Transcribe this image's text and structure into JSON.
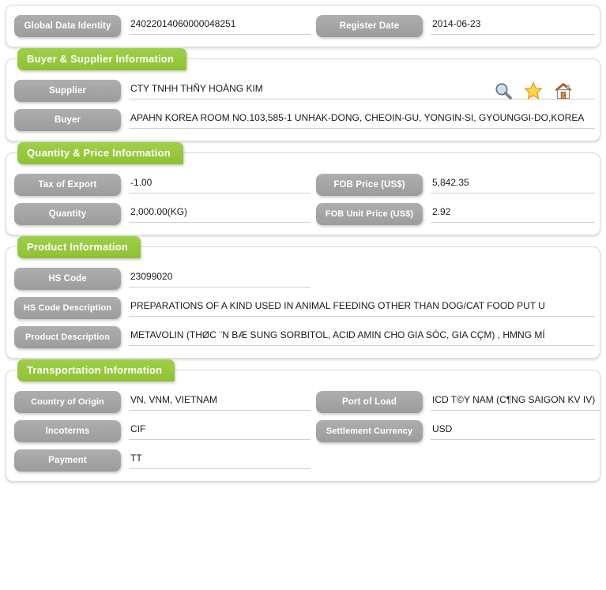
{
  "top": {
    "fields": [
      {
        "label": "Global Data Identity",
        "value": "24022014060000048251"
      },
      {
        "label": "Register Date",
        "value": "2014-06-23"
      }
    ]
  },
  "sections": [
    {
      "title": "Buyer & Supplier Information",
      "fields": [
        {
          "label": "Supplier",
          "value": "CTY TNHH THÑY HOÀNG KIM"
        },
        {
          "label": "Buyer",
          "value": "APAHN KOREA ROOM NO.103,585-1 UNHAK-DONG, CHEOIN-GU, YONGIN-SI, GYOUNGGI-DO,KOREA"
        }
      ],
      "icons": [
        {
          "name": "search-icon",
          "title": "search"
        },
        {
          "name": "star-icon",
          "title": "favorite"
        },
        {
          "name": "home-icon",
          "title": "home"
        }
      ]
    },
    {
      "title": "Quantity & Price Information",
      "fields": [
        {
          "label": "Tax of Export",
          "value": "-1.00"
        },
        {
          "label": "FOB Price (US$)",
          "value": "5,842.35"
        },
        {
          "label": "Quantity",
          "value": "2,000.00(KG)"
        },
        {
          "label": "FOB Unit Price (US$)",
          "value": "2.92"
        }
      ]
    },
    {
      "title": "Product Information",
      "fields": [
        {
          "label": "HS Code",
          "value": "23099020"
        },
        {
          "label": "HS Code Description",
          "value": "PREPARATIONS OF A KIND USED IN ANIMAL FEEDING OTHER THAN DOG/CAT FOOD PUT U"
        },
        {
          "label": "Product Description",
          "value": "METAVOLIN (THØC ¨N BÆ SUNG SORBITOL, ACID AMIN CHO GIA SÓC, GIA CÇM) , HMNG MÍ"
        }
      ]
    },
    {
      "title": "Transportation Information",
      "fields": [
        {
          "label": "Country of Origin",
          "value": "VN, VNM, VIETNAM"
        },
        {
          "label": "Port of Load",
          "value": "ICD T©Y NAM (C¶NG SAIGON KV IV)"
        },
        {
          "label": "Incoterms",
          "value": "CIF"
        },
        {
          "label": "Settlement Currency",
          "value": "USD"
        },
        {
          "label": "Payment",
          "value": "TT"
        }
      ]
    }
  ],
  "colors": {
    "section_green": "#96c83c",
    "pill_gray": "#a3a3a3",
    "underline": "#cfcfcf",
    "text": "#1a1a1a"
  }
}
